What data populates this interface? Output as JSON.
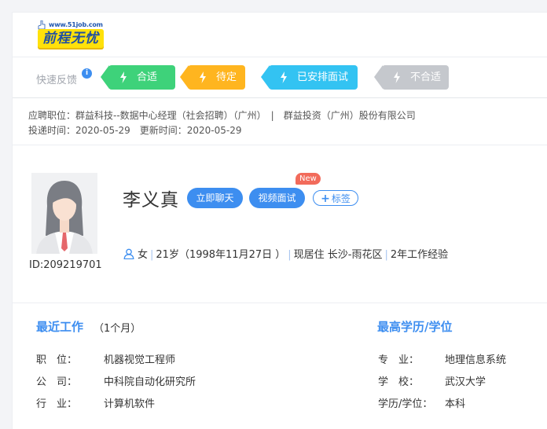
{
  "header": {
    "logo_url_text": "www.51job.com",
    "logo_text": "前程无忧"
  },
  "feedback": {
    "label": "快速反馈",
    "info_glyph": "i",
    "buttons": [
      {
        "label": "合适",
        "color": "#3ed27a"
      },
      {
        "label": "待定",
        "color": "#ffb51f"
      },
      {
        "label": "已安排面试",
        "color": "#33c3f2"
      },
      {
        "label": "不合适",
        "color": "#c5c8cd"
      }
    ]
  },
  "application": {
    "position_line": "应聘职位：群益科技--数据中心经理（社会招聘）（广州）　|　群益投资（广州）股份有限公司",
    "time_line": "投递时间：2020-05-29　更新时间：2020-05-29"
  },
  "candidate": {
    "id_text": "ID:209219701",
    "name": "李义真",
    "chat_label": "立即聊天",
    "video_label": "视频面试",
    "new_badge": "New",
    "tag_plus": "+",
    "tag_label": "标签",
    "gender": "女",
    "age": "21岁（1998年11月27日 ）",
    "residence": "现居住 长沙-雨花区",
    "experience": "2年工作经验",
    "separator": "|"
  },
  "recent_work": {
    "title": "最近工作",
    "duration": "（1个月）",
    "rows": [
      {
        "label": "职　位：",
        "value": "机器视觉工程师"
      },
      {
        "label": "公　司：",
        "value": "中科院自动化研究所"
      },
      {
        "label": "行　业：",
        "value": "计算机软件"
      }
    ]
  },
  "education": {
    "title": "最高学历/学位",
    "rows": [
      {
        "label": "专　业：",
        "value": "地理信息系统"
      },
      {
        "label": "学　校：",
        "value": "武汉大学"
      },
      {
        "label": "学历/学位：",
        "value": "本科"
      }
    ]
  },
  "colors": {
    "accent": "#3d8ef0",
    "logo_yellow": "#ffe10a",
    "new_badge": "#f26b5b"
  }
}
